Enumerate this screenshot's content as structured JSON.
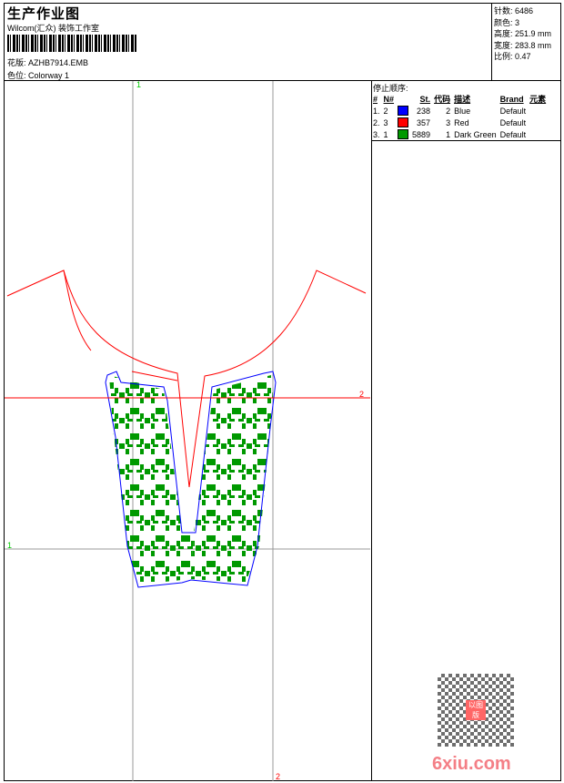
{
  "header": {
    "title": "生产作业图",
    "company": "Wilcom(汇众) 装饰工作室",
    "design_label": "花版:",
    "design_value": "AZHB7914.EMB",
    "colorway_label": "色位:",
    "colorway_value": "Colorway 1"
  },
  "stats": [
    {
      "label": "针数:",
      "value": "6486"
    },
    {
      "label": "颜色:",
      "value": "3"
    },
    {
      "label": "高度:",
      "value": "251.9 mm"
    },
    {
      "label": "宽度:",
      "value": "283.8 mm"
    },
    {
      "label": "比例:",
      "value": "0.47"
    }
  ],
  "stop_sequence": {
    "title": "停止顺序:",
    "columns": [
      "#",
      "N#",
      "",
      "St.",
      "代码",
      "描述",
      "Brand",
      "元素"
    ],
    "rows": [
      {
        "idx": "1.",
        "n": "2",
        "color": "#0000ff",
        "st": "238",
        "code": "2",
        "desc": "Blue",
        "brand": "Default"
      },
      {
        "idx": "2.",
        "n": "3",
        "color": "#ff0000",
        "st": "357",
        "code": "3",
        "desc": "Red",
        "brand": "Default"
      },
      {
        "idx": "3.",
        "n": "1",
        "color": "#009900",
        "st": "5889",
        "code": "1",
        "desc": "Dark Green",
        "brand": "Default"
      }
    ]
  },
  "grid_labels": {
    "v1": "1",
    "h1": "1",
    "h2": "2",
    "v2": "2"
  },
  "watermark": {
    "stamp": "以图版",
    "site": "6xiu.com"
  },
  "colors": {
    "blue": "#0000ff",
    "red": "#ff0000",
    "green": "#009900",
    "grid": "#999999"
  }
}
